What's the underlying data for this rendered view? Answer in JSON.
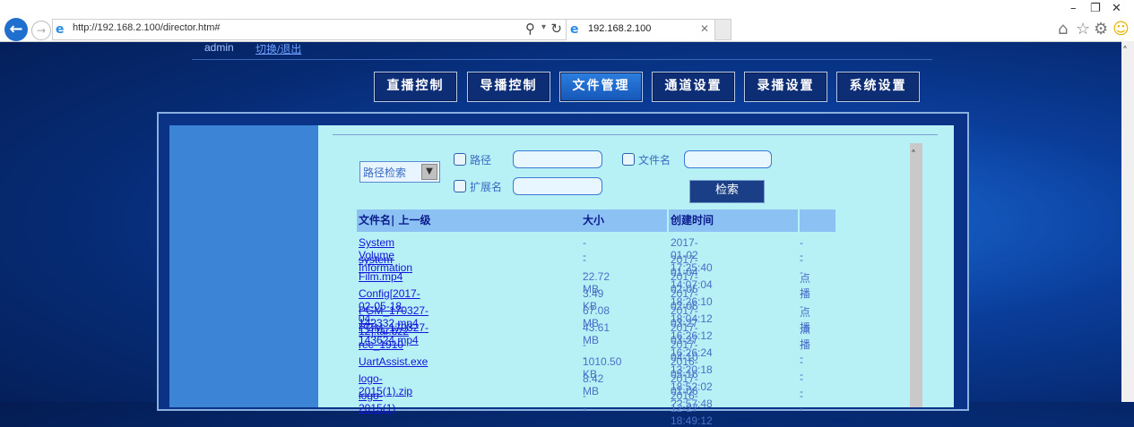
{
  "browser": {
    "url": "http://192.168.2.100/director.htm#",
    "tab_title": "192.168.2.100"
  },
  "header": {
    "user": "admin",
    "switch_link": "切换/退出"
  },
  "nav": [
    {
      "label": "直播控制",
      "active": false
    },
    {
      "label": "导播控制",
      "active": false
    },
    {
      "label": "文件管理",
      "active": true
    },
    {
      "label": "通道设置",
      "active": false
    },
    {
      "label": "录播设置",
      "active": false
    },
    {
      "label": "系统设置",
      "active": false
    }
  ],
  "search": {
    "mode_selected": "路径检索",
    "path_label": "路径",
    "filename_label": "文件名",
    "ext_label": "扩展名",
    "button": "检索"
  },
  "table": {
    "headers": {
      "name": "文件名",
      "parent": "| 上一级",
      "size": "大小",
      "time": "创建时间",
      "action": ""
    },
    "rows": [
      {
        "name": "System Volume Information",
        "size": "--",
        "time": "2017-01-02 17:25:40",
        "action": "--"
      },
      {
        "name": "system",
        "size": "--",
        "time": "2017-01-04 14:07:04",
        "action": "--"
      },
      {
        "name": "Film.mp4",
        "size": "22.72 MB",
        "time": "2017-02-05 18:26:10",
        "action": "点播"
      },
      {
        "name": "Config[2017-02-05-18-04-12].tar.bz2",
        "size": "3.49 KB",
        "time": "2017-02-05 18:04:12",
        "action": "--"
      },
      {
        "name": "PGM_170327-142332.mp4",
        "size": "67.08 MB",
        "time": "2017-03-27 16:26:12",
        "action": "点播"
      },
      {
        "name": "PGM_170327-143624.mp4",
        "size": "43.61 MB",
        "time": "2017-03-27 16:26:24",
        "action": "点播"
      },
      {
        "name": "rec_1910",
        "size": "--",
        "time": "2017-04-10 13:20:18",
        "action": "--"
      },
      {
        "name": "UartAssist.exe",
        "size": "1010.50 KB",
        "time": "2016-05-16 18:52:02",
        "action": "--"
      },
      {
        "name": "logo-2015(1).zip",
        "size": "8.42 MB",
        "time": "2017-01-06 ??:57:48",
        "action": "--"
      },
      {
        "name": "logo-2015(1)",
        "size": "--",
        "time": "2016-12-27 18:49:12",
        "action": "--"
      }
    ]
  }
}
